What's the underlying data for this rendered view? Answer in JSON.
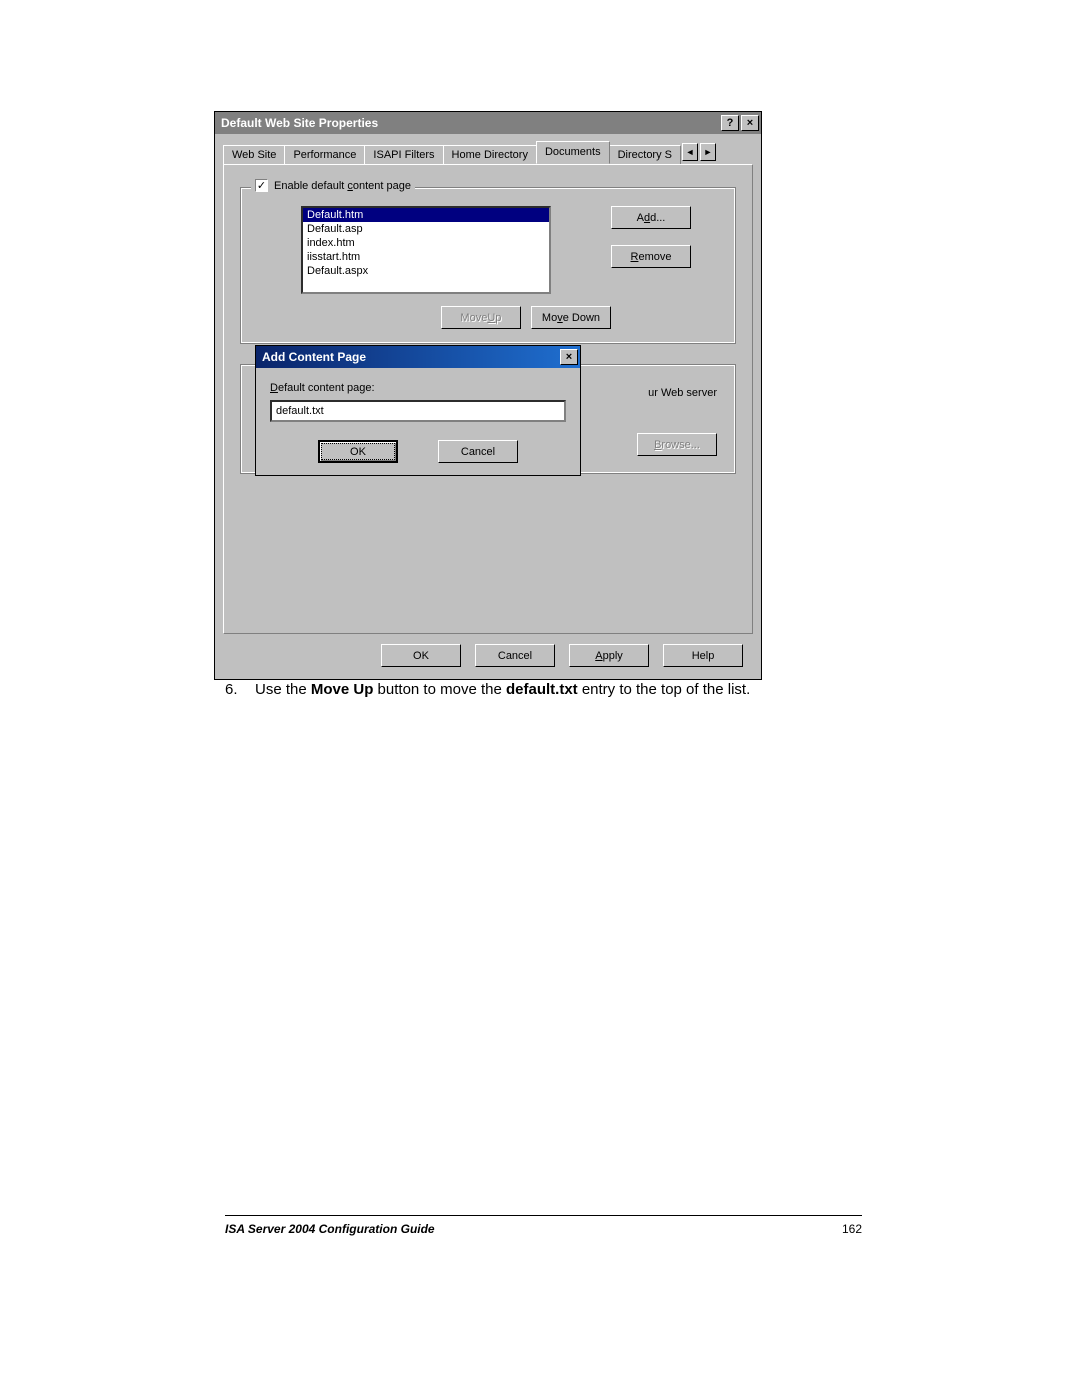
{
  "main_window": {
    "title": "Default Web Site Properties",
    "help_btn": "?",
    "close_btn": "×",
    "tabs": {
      "t0": "Web Site",
      "t1": "Performance",
      "t2": "ISAPI Filters",
      "t3": "Home Directory",
      "t4": "Documents",
      "t5": "Directory S",
      "left_arrow": "◄",
      "right_arrow": "►"
    },
    "group_label_pre": "Enable default ",
    "group_label_uchar": "c",
    "group_label_post": "ontent page",
    "list": {
      "i0": "Default.htm",
      "i1": "Default.asp",
      "i2": "index.htm",
      "i3": "iisstart.htm",
      "i4": "Default.aspx"
    },
    "add_pre": "A",
    "add_u": "d",
    "add_post": "d...",
    "remove_u": "R",
    "remove_post": "emove",
    "moveup_pre": "Move ",
    "moveup_u": "U",
    "moveup_post": "p",
    "movedown_pre": "Mo",
    "movedown_u": "v",
    "movedown_post": "e Down",
    "partial_text": "ur Web server",
    "browse_u": "B",
    "browse_post": "rowse...",
    "ok": "OK",
    "cancel": "Cancel",
    "apply_u": "A",
    "apply_post": "pply",
    "help": "Help"
  },
  "dialog": {
    "title": "Add Content Page",
    "close_btn": "×",
    "label_u": "D",
    "label_post": "efault content page:",
    "value": "default.txt",
    "ok": "OK",
    "cancel": "Cancel"
  },
  "doc": {
    "step_no": "6.",
    "step_pre": "Use the ",
    "step_b1": "Move Up",
    "step_mid": " button to move the ",
    "step_b2": "default.txt",
    "step_post": " entry to the top of the list."
  },
  "footer": {
    "title": "ISA Server 2004 Configuration Guide",
    "page": "162"
  }
}
